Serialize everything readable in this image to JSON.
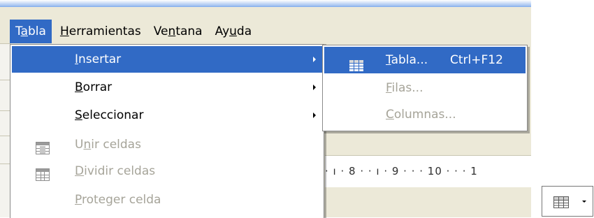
{
  "menubar": {
    "items": [
      {
        "pre": "T",
        "mn": "a",
        "post": "bla"
      },
      {
        "pre": "",
        "mn": "H",
        "post": "erramientas"
      },
      {
        "pre": "Ve",
        "mn": "n",
        "post": "tana"
      },
      {
        "pre": "Ay",
        "mn": "u",
        "post": "da"
      }
    ]
  },
  "tabla_menu": {
    "items": [
      {
        "pre": "",
        "mn": "I",
        "post": "nsertar",
        "state": "highlighted",
        "submenu": true
      },
      {
        "pre": "",
        "mn": "B",
        "post": "orrar",
        "state": "enabled",
        "submenu": true
      },
      {
        "pre": "",
        "mn": "S",
        "post": "eleccionar",
        "state": "enabled",
        "submenu": true
      },
      {
        "pre": "U",
        "mn": "n",
        "post": "ir celdas",
        "state": "disabled",
        "icon": "merge-cells-icon"
      },
      {
        "pre": "",
        "mn": "D",
        "post": "ividir celdas",
        "state": "disabled",
        "icon": "split-cells-icon"
      },
      {
        "pre": "",
        "mn": "P",
        "post": "roteger celda",
        "state": "disabled"
      }
    ]
  },
  "insertar_submenu": {
    "items": [
      {
        "pre": "",
        "mn": "T",
        "post": "abla...",
        "shortcut": "Ctrl+F12",
        "state": "highlighted",
        "icon": "table-icon"
      },
      {
        "pre": "",
        "mn": "F",
        "post": "ilas...",
        "state": "disabled"
      },
      {
        "pre": "",
        "mn": "C",
        "post": "olumnas...",
        "state": "disabled"
      }
    ]
  },
  "ruler": {
    "text": "· ı · 8 · · ı · 9 · · · 10 · · · 1"
  },
  "colors": {
    "highlight": "#316ac5",
    "disabled": "#a6a499",
    "menu_bg": "#ffffff",
    "app_bg": "#ece9d8"
  }
}
